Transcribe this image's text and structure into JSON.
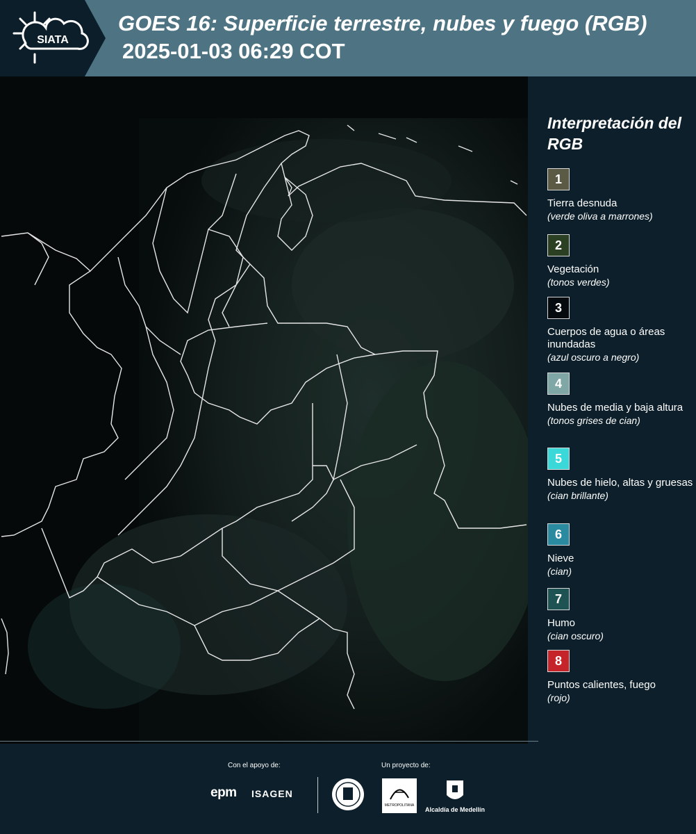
{
  "header": {
    "logo_text": "SIATA",
    "title": "GOES 16: Superficie terrestre, nubes y fuego (RGB)",
    "subtitle": "2025-01-03 06:29 COT",
    "colors": {
      "band": "#4e7484",
      "dark": "#0b1e2a"
    }
  },
  "legend": {
    "title": "Interpretación del RGB",
    "items": [
      {
        "num": "1",
        "color": "#5b5a45",
        "label": "Tierra desnuda",
        "desc": "(verde oliva a marrones)"
      },
      {
        "num": "2",
        "color": "#2b3f22",
        "label": "Vegetación",
        "desc": "(tonos verdes)"
      },
      {
        "num": "3",
        "color": "#050a0f",
        "label": "Cuerpos de agua o áreas inundadas",
        "desc": "(azul oscuro a negro)"
      },
      {
        "num": "4",
        "color": "#7fa7a6",
        "label": "Nubes de media y baja altura",
        "desc": "(tonos grises de cian)"
      },
      {
        "num": "5",
        "color": "#3ad8d8",
        "label": "Nubes de hielo, altas y gruesas",
        "desc": "(cian brillante)"
      },
      {
        "num": "6",
        "color": "#2a8ba0",
        "label": "Nieve",
        "desc": "(cian)"
      },
      {
        "num": "7",
        "color": "#1f5253",
        "label": "Humo",
        "desc": "(cian oscuro)"
      },
      {
        "num": "8",
        "color": "#c4242a",
        "label": "Puntos calientes, fuego",
        "desc": "(rojo)"
      }
    ]
  },
  "footer": {
    "support_caption": "Con el apoyo de:",
    "project_caption": "Un proyecto de:",
    "sponsors": [
      "epm",
      "ISAGEN"
    ],
    "partners": [
      "Área Metropolitana",
      "Alcaldía de Medellín"
    ],
    "alcaldia_label": "Alcaldía de Medellín",
    "area_label": "METROPOLITANA"
  }
}
